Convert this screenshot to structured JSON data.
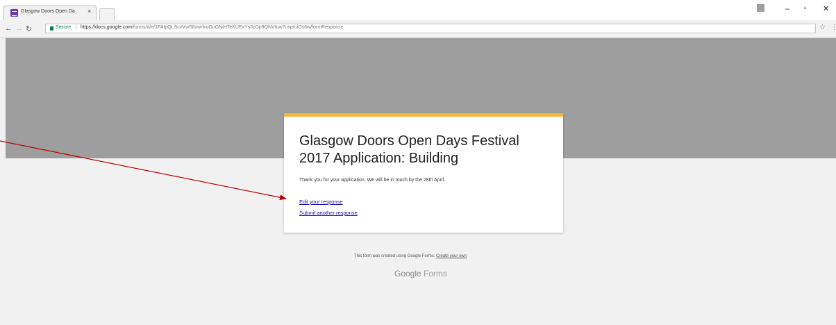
{
  "browser": {
    "tab_title": "Glasgow Doors Open Da",
    "tab_close": "×",
    "secure_label": "Secure",
    "url_host": "https://docs.google.com",
    "url_path": "/forms/d/e/1FAIpQLScvVwS8xwnkuGoGNiHTeKUExYsJzOp9QNVtuw?usp/uiOs6w/formResponse",
    "win_min": "–",
    "win_max": "▫",
    "win_close": "✕"
  },
  "form": {
    "title": "Glasgow Doors Open Days Festival 2017 Application: Building",
    "confirmation": "Thank you for your application. We will be in touch by the 28th April.",
    "edit_link": "Edit your response",
    "another_link": "Submit another response"
  },
  "footer": {
    "note": "This form was created using Google Forms.",
    "create_link": "Create your own",
    "logo_google": "Google",
    "logo_forms": "Forms"
  },
  "colors": {
    "banner": "#9e9e9e",
    "accent": "#f6b73c",
    "arrow": "#c00000",
    "link": "#1a0dab"
  }
}
